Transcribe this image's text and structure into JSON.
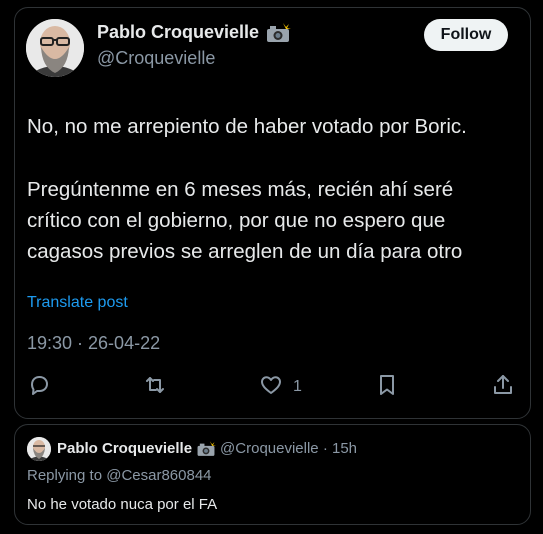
{
  "tweet": {
    "author": {
      "display_name": "Pablo Croquevielle",
      "handle": "@Croquevielle",
      "emoji_icon": "camera-flash-icon",
      "avatar": "bald-bearded-man-glasses"
    },
    "follow_label": "Follow",
    "text_lines_1": [
      "No, no me arrepiento de haber votado por Boric."
    ],
    "text_lines_2": [
      "Pregúntenme en 6 meses más, recién ahí seré",
      "crítico con el gobierno, por que no espero que",
      "cagasos previos se arreglen de un día para otro"
    ],
    "translate_label": "Translate post",
    "timestamp": "19:30 · 26-04-22",
    "actions": {
      "reply_icon": "reply-icon",
      "retweet_icon": "retweet-icon",
      "like_icon": "heart-icon",
      "like_count": "1",
      "bookmark_icon": "bookmark-icon",
      "share_icon": "share-icon"
    }
  },
  "reply": {
    "display_name": "Pablo Croquevielle",
    "handle_time": "@Croquevielle · 15h",
    "replying_to": "Replying to @Cesar860844",
    "text": "No he votado nuca por el FA"
  },
  "colors": {
    "background": "#000000",
    "text": "#e7e9ea",
    "muted": "#8b98a5",
    "link": "#1d9bf0",
    "border": "#2f3336",
    "follow_bg": "#eff3f4"
  }
}
